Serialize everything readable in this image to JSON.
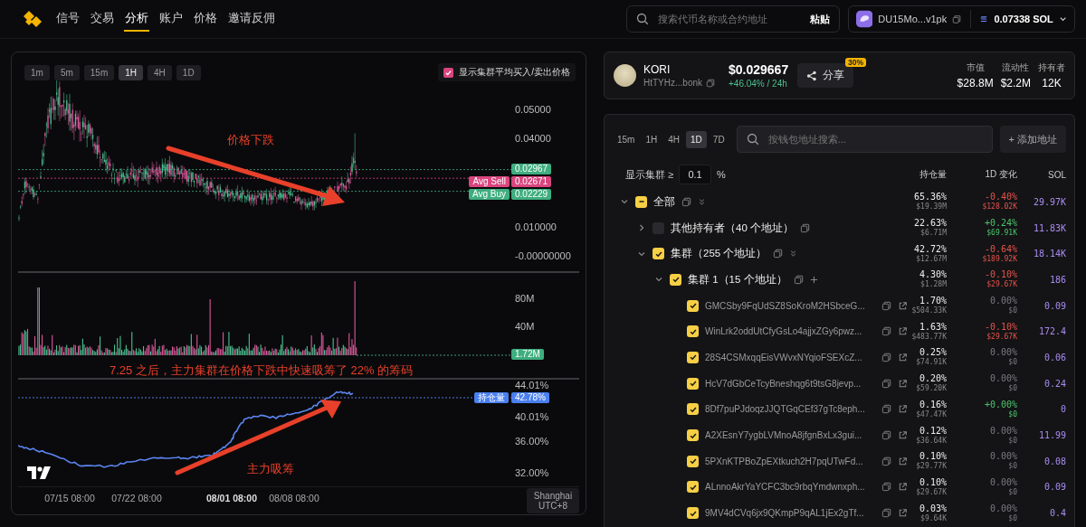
{
  "header": {
    "nav": [
      {
        "label": "信号",
        "selected": false
      },
      {
        "label": "交易",
        "selected": false
      },
      {
        "label": "分析",
        "selected": true
      },
      {
        "label": "账户",
        "selected": false
      },
      {
        "label": "价格",
        "selected": false
      },
      {
        "label": "邀请反佣",
        "selected": false
      }
    ],
    "search": {
      "placeholder": "搜索代币名称或合约地址",
      "paste": "粘贴"
    },
    "wallet": {
      "address": "DU15Mo...v1pk",
      "balance": "0.07338 SOL"
    }
  },
  "chart": {
    "intervals": [
      {
        "label": "1m",
        "selected": false
      },
      {
        "label": "5m",
        "selected": false
      },
      {
        "label": "15m",
        "selected": false
      },
      {
        "label": "1H",
        "selected": true
      },
      {
        "label": "4H",
        "selected": false
      },
      {
        "label": "1D",
        "selected": false
      }
    ],
    "avg_toggle": {
      "label": "显示集群平均买入/卖出价格",
      "checked": true
    },
    "price_axis": [
      "0.05000",
      "0.04000",
      "0.010000",
      "-0.00000000"
    ],
    "price_tags": [
      {
        "kind": "last",
        "value": "0.02967"
      },
      {
        "kind": "sell",
        "label": "Avg Sell",
        "value": "0.02671"
      },
      {
        "kind": "buy",
        "label": "Avg Buy",
        "value": "0.02229"
      }
    ],
    "volume_axis": [
      "80M",
      "40M"
    ],
    "volume_tag": "1.72M",
    "holding_axis": [
      "44.01%",
      "40.01%",
      "36.00%",
      "32.00%"
    ],
    "holding_tag": {
      "label": "持仓量",
      "value": "42.78%"
    },
    "time_axis": [
      {
        "label": "07/15 08:00",
        "bold": false
      },
      {
        "label": "07/22 08:00",
        "bold": false
      },
      {
        "label": "08/01 08:00",
        "bold": true
      },
      {
        "label": "08/08 08:00",
        "bold": false
      }
    ],
    "timezone": [
      "Shanghai",
      "UTC+8"
    ],
    "annotations": [
      "价格下跌",
      "7.25 之后，主力集群在价格下跌中快速吸筹了 22% 的筹码",
      "主力吸筹"
    ]
  },
  "token": {
    "name": "KORI",
    "address": "HtTYHz...bonk",
    "price": "$0.029667",
    "change": "+46.04% / 24h",
    "share": "分享",
    "share_badge": "30%",
    "stats": [
      {
        "label": "市值",
        "value": "$28.8M"
      },
      {
        "label": "流动性",
        "value": "$2.2M"
      },
      {
        "label": "持有者",
        "value": "12K"
      }
    ]
  },
  "holders": {
    "intervals": [
      {
        "label": "15m",
        "selected": false
      },
      {
        "label": "1H",
        "selected": false
      },
      {
        "label": "4H",
        "selected": false
      },
      {
        "label": "1D",
        "selected": true
      },
      {
        "label": "7D",
        "selected": false
      }
    ],
    "search_placeholder": "按钱包地址搜索...",
    "add": "+ 添加地址",
    "threshold_label": "显示集群 ≥",
    "threshold": "0.1",
    "threshold_unit": "%",
    "columns": [
      "持仓量",
      "1D 变化",
      "SOL"
    ],
    "rows": [
      {
        "kind": "group",
        "name": "全部",
        "checked": true,
        "partial": true,
        "expanded": true,
        "share": "65.36%",
        "share_usd": "$19.39M",
        "change": "-0.40%",
        "change_usd": "$128.02K",
        "color": "#e5534b",
        "sol": "29.97K",
        "children": [
          {
            "kind": "other",
            "name": "其他持有者（40 个地址）",
            "checked": false,
            "partial": false,
            "expanded": false,
            "share": "22.63%",
            "share_usd": "$6.71M",
            "change": "+0.24%",
            "change_usd": "$69.91K",
            "color": "#4cc46a",
            "sol": "11.83K"
          },
          {
            "kind": "group",
            "name": "集群（255 个地址）",
            "checked": true,
            "partial": false,
            "expanded": true,
            "share": "42.72%",
            "share_usd": "$12.67M",
            "change": "-0.64%",
            "change_usd": "$189.92K",
            "color": "#e5534b",
            "sol": "18.14K",
            "children": [
              {
                "kind": "cluster",
                "name": "集群 1（15 个地址）",
                "checked": true,
                "partial": false,
                "expanded": true,
                "share": "4.30%",
                "share_usd": "$1.28M",
                "change": "-0.10%",
                "change_usd": "$29.67K",
                "color": "#e5534b",
                "sol": "186",
                "children": [
                  {
                    "kind": "address",
                    "name": "GMCSby9FqUdSZ8SoKroM2HSbceG...",
                    "checked": true,
                    "partial": false,
                    "share": "1.70%",
                    "share_usd": "$504.33K",
                    "change": "0.00%",
                    "change_usd": "$0",
                    "color": "#7a7a80",
                    "sol": "0.09"
                  },
                  {
                    "kind": "address",
                    "name": "WinLrk2oddUtCfyGsLo4ajjxZGy6pwz...",
                    "checked": true,
                    "partial": false,
                    "share": "1.63%",
                    "share_usd": "$483.77K",
                    "change": "-0.10%",
                    "change_usd": "$29.67K",
                    "color": "#e5534b",
                    "sol": "172.4"
                  },
                  {
                    "kind": "address",
                    "name": "28S4CSMxqqEisVWvxNYqioFSEXcZ...",
                    "checked": true,
                    "partial": false,
                    "share": "0.25%",
                    "share_usd": "$74.91K",
                    "change": "0.00%",
                    "change_usd": "$0",
                    "color": "#7a7a80",
                    "sol": "0.06"
                  },
                  {
                    "kind": "address",
                    "name": "HcV7dGbCeTcyBneshqg6t9tsG8jevp...",
                    "checked": true,
                    "partial": false,
                    "share": "0.20%",
                    "share_usd": "$59.20K",
                    "change": "0.00%",
                    "change_usd": "$0",
                    "color": "#7a7a80",
                    "sol": "0.24"
                  },
                  {
                    "kind": "address",
                    "name": "8Df7puPJdoqzJJQTGqCEf37gTc8eph...",
                    "checked": true,
                    "partial": false,
                    "share": "0.16%",
                    "share_usd": "$47.47K",
                    "change": "+0.00%",
                    "change_usd": "$0",
                    "color": "#4cc46a",
                    "sol": "0"
                  },
                  {
                    "kind": "address",
                    "name": "A2XEsnY7ygbLVMnoA8jfgnBxLx3gui...",
                    "checked": true,
                    "partial": false,
                    "share": "0.12%",
                    "share_usd": "$36.64K",
                    "change": "0.00%",
                    "change_usd": "$0",
                    "color": "#7a7a80",
                    "sol": "11.99"
                  },
                  {
                    "kind": "address",
                    "name": "5PXnKTPBoZpEXtkuch2H7pqUTwFd...",
                    "checked": true,
                    "partial": false,
                    "share": "0.10%",
                    "share_usd": "$29.77K",
                    "change": "0.00%",
                    "change_usd": "$0",
                    "color": "#7a7a80",
                    "sol": "0.08"
                  },
                  {
                    "kind": "address",
                    "name": "ALnnoAkrYaYCFC3bc9rbqYmdwnxph...",
                    "checked": true,
                    "partial": false,
                    "share": "0.10%",
                    "share_usd": "$29.67K",
                    "change": "0.00%",
                    "change_usd": "$0",
                    "color": "#7a7a80",
                    "sol": "0.09"
                  },
                  {
                    "kind": "address",
                    "name": "9MV4dCVq6jx9QKmpP9qAL1jEx2gTf...",
                    "checked": true,
                    "partial": false,
                    "share": "0.03%",
                    "share_usd": "$9.64K",
                    "change": "0.00%",
                    "change_usd": "$0",
                    "color": "#7a7a80",
                    "sol": "0.4"
                  }
                ]
              }
            ]
          }
        ]
      }
    ]
  }
}
